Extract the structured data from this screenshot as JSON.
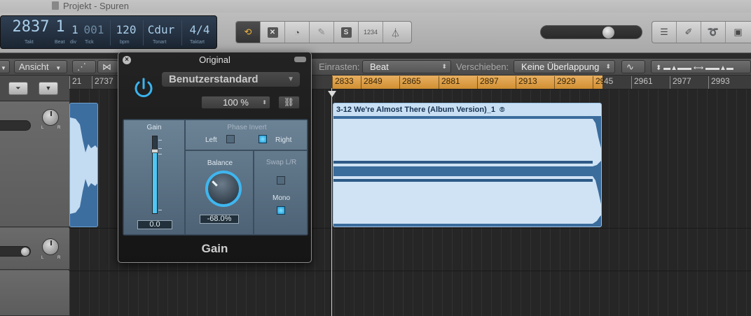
{
  "window": {
    "title": "Projekt - Spuren"
  },
  "lcd": {
    "takt": "2837",
    "takt_label": "Takt",
    "beat": "1",
    "beat_label": "Beat",
    "div": "1",
    "div_label": "div",
    "tick": "001",
    "tick_label": "Tick",
    "bpm": "120",
    "bpm_label": "bpm",
    "tonart": "Cdur",
    "tonart_label": "Tonart",
    "taktart": "4/4",
    "taktart_label": "Taktart"
  },
  "toolbar": {
    "buttons": [
      "cycle-icon",
      "replace-icon",
      "tuner-icon",
      "count-in-icon",
      "solo-icon",
      "1234",
      "metronome-icon"
    ],
    "solo_label": "S",
    "count_label": "1234",
    "right_buttons": [
      "list-icon",
      "notepad-icon",
      "loop-browser-icon",
      "media-browser-icon"
    ]
  },
  "secondbar": {
    "view_label": "Ansicht",
    "snap_label": "Einrasten:",
    "snap_value": "Beat",
    "drag_label": "Verschieben:",
    "drag_value": "Keine Überlappung"
  },
  "ruler": {
    "pre_ticks": [
      "21",
      "2737"
    ],
    "cycle_ticks": [
      "2833",
      "2849",
      "2865",
      "2881",
      "2897",
      "2913",
      "2929",
      "29"
    ],
    "post_ticks": [
      "45",
      "2961",
      "2977",
      "2993"
    ]
  },
  "region": {
    "title": "3-12 We're Almost There (Album Version)_1"
  },
  "plugin": {
    "title": "Original",
    "preset": "Benutzerstandard",
    "percent": "100 %",
    "gain_label": "Gain",
    "gain_value": "0.0",
    "phase_invert_label": "Phase Invert",
    "left_label": "Left",
    "right_label": "Right",
    "balance_label": "Balance",
    "balance_value": "-68.0%",
    "swap_label": "Swap L/R",
    "mono_label": "Mono",
    "name": "Gain",
    "phase_left_on": false,
    "phase_right_on": true,
    "swap_on": false,
    "mono_on": true
  },
  "colors": {
    "accent": "#4fc7f5",
    "cycle": "#e0a34c",
    "region": "#3a6c9c"
  }
}
